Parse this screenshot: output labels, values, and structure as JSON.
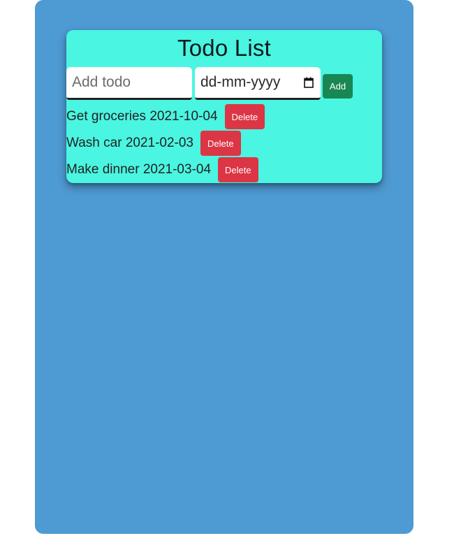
{
  "app": {
    "title": "Todo List"
  },
  "form": {
    "todo_placeholder": "Add todo",
    "date_placeholder": "dd-mm-yyyy",
    "add_label": "Add"
  },
  "todos": [
    {
      "text": "Get groceries 2021-10-04",
      "delete_label": "Delete"
    },
    {
      "text": "Wash car 2021-02-03",
      "delete_label": "Delete"
    },
    {
      "text": "Make dinner 2021-03-04",
      "delete_label": "Delete"
    }
  ],
  "colors": {
    "outer_panel": "#4e9ad2",
    "card": "#4af5e1",
    "add_button": "#198754",
    "delete_button": "#dc3545"
  },
  "icons": {
    "date_picker": "calendar-icon"
  }
}
